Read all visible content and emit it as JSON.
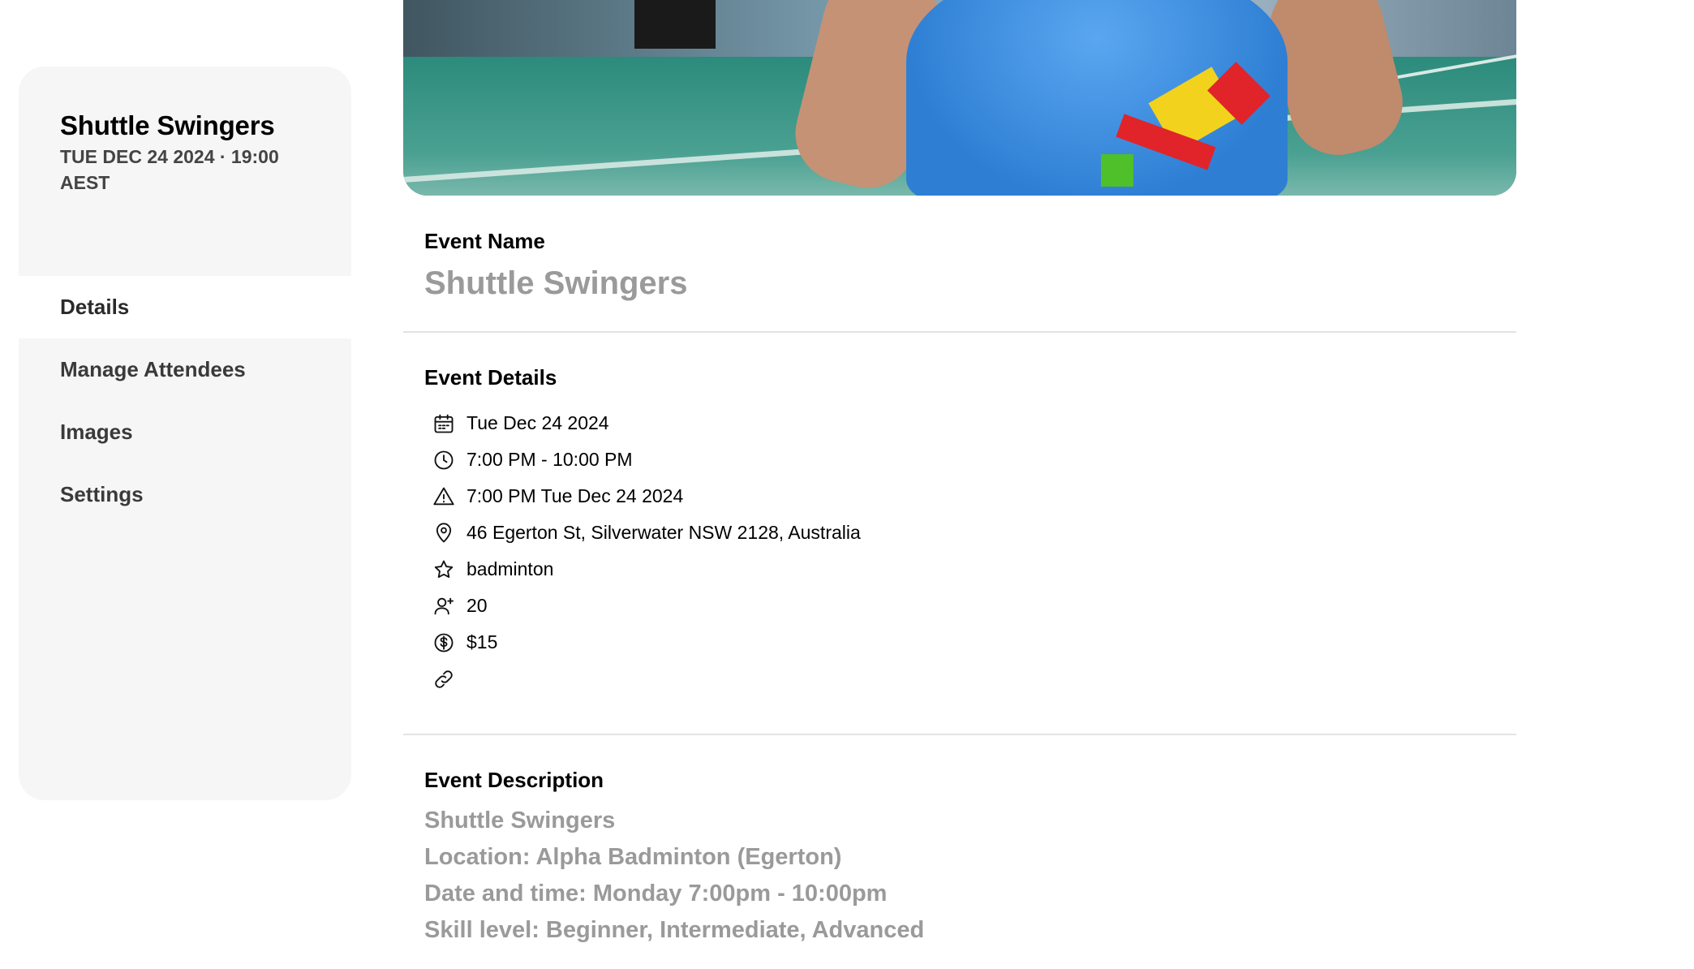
{
  "sidebar": {
    "title": "Shuttle Swingers",
    "subtitle": "TUE DEC 24 2024 · 19:00 AEST",
    "nav": [
      {
        "label": "Details",
        "active": true
      },
      {
        "label": "Manage Attendees",
        "active": false
      },
      {
        "label": "Images",
        "active": false
      },
      {
        "label": "Settings",
        "active": false
      }
    ]
  },
  "event_name": {
    "label": "Event Name",
    "value": "Shuttle Swingers"
  },
  "event_details": {
    "label": "Event Details",
    "items": [
      {
        "icon": "calendar-icon",
        "text": "Tue Dec 24 2024"
      },
      {
        "icon": "clock-icon",
        "text": "7:00 PM - 10:00 PM"
      },
      {
        "icon": "warning-icon",
        "text": "7:00 PM Tue Dec 24 2024"
      },
      {
        "icon": "location-pin-icon",
        "text": "46 Egerton St, Silverwater NSW 2128, Australia"
      },
      {
        "icon": "star-icon",
        "text": "badminton"
      },
      {
        "icon": "add-user-icon",
        "text": "20"
      },
      {
        "icon": "dollar-icon",
        "text": "$15"
      },
      {
        "icon": "link-icon",
        "text": ""
      }
    ]
  },
  "event_description": {
    "label": "Event Description",
    "lines": [
      "Shuttle Swingers",
      "Location: Alpha Badminton (Egerton)",
      "Date and time: Monday 7:00pm - 10:00pm",
      "Skill level: Beginner, Intermediate, Advanced"
    ]
  }
}
